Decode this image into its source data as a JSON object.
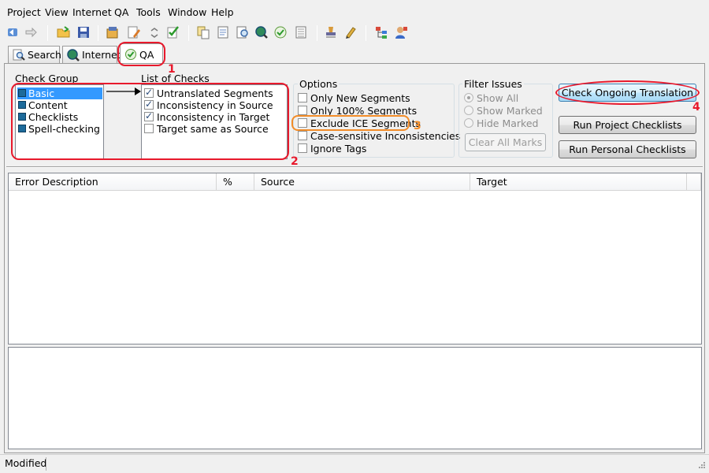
{
  "menu": [
    "Project",
    "View",
    "Internet",
    "QA",
    "Tools",
    "Window",
    "Help"
  ],
  "toolbar_icons": [
    "back-icon",
    "forward-icon",
    "open-folder-icon",
    "save-icon",
    "project-settings-icon",
    "edit-icon",
    "small-arrows-icon",
    "check-edit-icon",
    "copy-icon",
    "document-icon",
    "find-icon",
    "search-globe-icon",
    "check-icon",
    "list-icon",
    "stamp-icon",
    "pen-icon",
    "tree-icon",
    "user-icon"
  ],
  "tabs": [
    {
      "label": "Search",
      "icon": "magnifier-icon",
      "active": false
    },
    {
      "label": "Internet",
      "icon": "globe-icon",
      "active": false
    },
    {
      "label": "QA",
      "icon": "qa-check-icon",
      "active": true
    }
  ],
  "check_group": {
    "label": "Check Group",
    "items": [
      {
        "label": "Basic",
        "selected": true
      },
      {
        "label": "Content",
        "selected": false
      },
      {
        "label": "Checklists",
        "selected": false
      },
      {
        "label": "Spell-checking",
        "selected": false
      }
    ]
  },
  "list_of_checks": {
    "label": "List of Checks",
    "items": [
      {
        "label": "Untranslated Segments",
        "checked": true
      },
      {
        "label": "Inconsistency in Source",
        "checked": true
      },
      {
        "label": "Inconsistency in Target",
        "checked": true
      },
      {
        "label": "Target same as Source",
        "checked": false
      }
    ]
  },
  "options": {
    "label": "Options",
    "items": [
      {
        "label": "Only New Segments",
        "checked": false
      },
      {
        "label": "Only 100% Segments",
        "checked": false
      },
      {
        "label": "Exclude ICE Segments",
        "checked": false
      },
      {
        "label": "Case-sensitive Inconsistencies",
        "checked": false
      },
      {
        "label": "Ignore Tags",
        "checked": false
      }
    ]
  },
  "filter_issues": {
    "label": "Filter Issues",
    "items": [
      {
        "label": "Show All",
        "selected": true
      },
      {
        "label": "Show Marked",
        "selected": false
      },
      {
        "label": "Hide Marked",
        "selected": false
      }
    ],
    "clear_button": "Clear All Marks"
  },
  "buttons": {
    "check_ongoing": "Check Ongoing Translation",
    "run_project": "Run Project Checklists",
    "run_personal": "Run Personal Checklists"
  },
  "table": {
    "columns": [
      "Error Description",
      "%",
      "Source",
      "Target"
    ]
  },
  "status": "Modified",
  "annotations": [
    "1",
    "2",
    "3",
    "4"
  ],
  "colors": {
    "annotation_red": "#e8192c",
    "annotation_orange": "#f28c28",
    "selection": "#3399ff"
  }
}
